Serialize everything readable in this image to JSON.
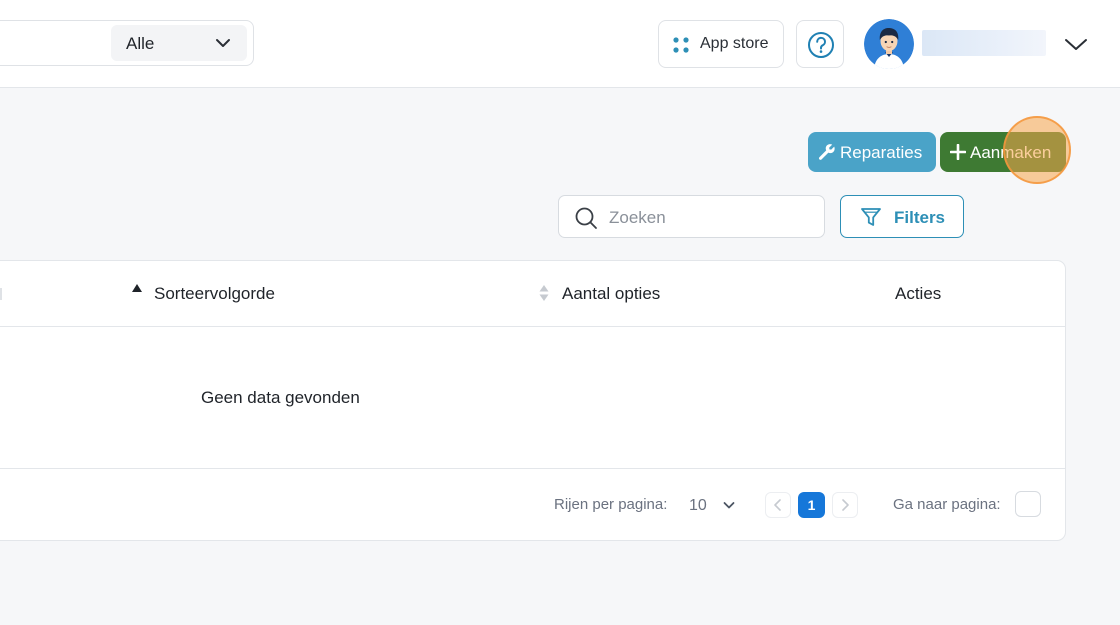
{
  "topbar": {
    "scope_select_value": "Alle",
    "app_store_label": "App store",
    "icons": [
      "apps-icon",
      "help-icon",
      "avatar",
      "chevron-down-icon"
    ]
  },
  "toolbar": {
    "repairs_label": "Reparaties",
    "create_label": "Aanmaken",
    "search_placeholder": "Zoeken",
    "filters_label": "Filters",
    "colors": {
      "repairs": "#4aa3c8",
      "create": "#3e7a33",
      "filters": "#2d8fb6"
    }
  },
  "table": {
    "columns": [
      "Sorteervolgorde",
      "Aantal opties",
      "Acties"
    ],
    "sort": {
      "column": "Sorteervolgorde",
      "direction": "ascending"
    },
    "empty_text": "Geen data gevonden"
  },
  "pagination": {
    "rows_per_page_label": "Rijen per pagina:",
    "rows_per_page_value": "10",
    "current_page": "1",
    "goto_label": "Ga naar pagina:",
    "accent": "#1677d9"
  }
}
